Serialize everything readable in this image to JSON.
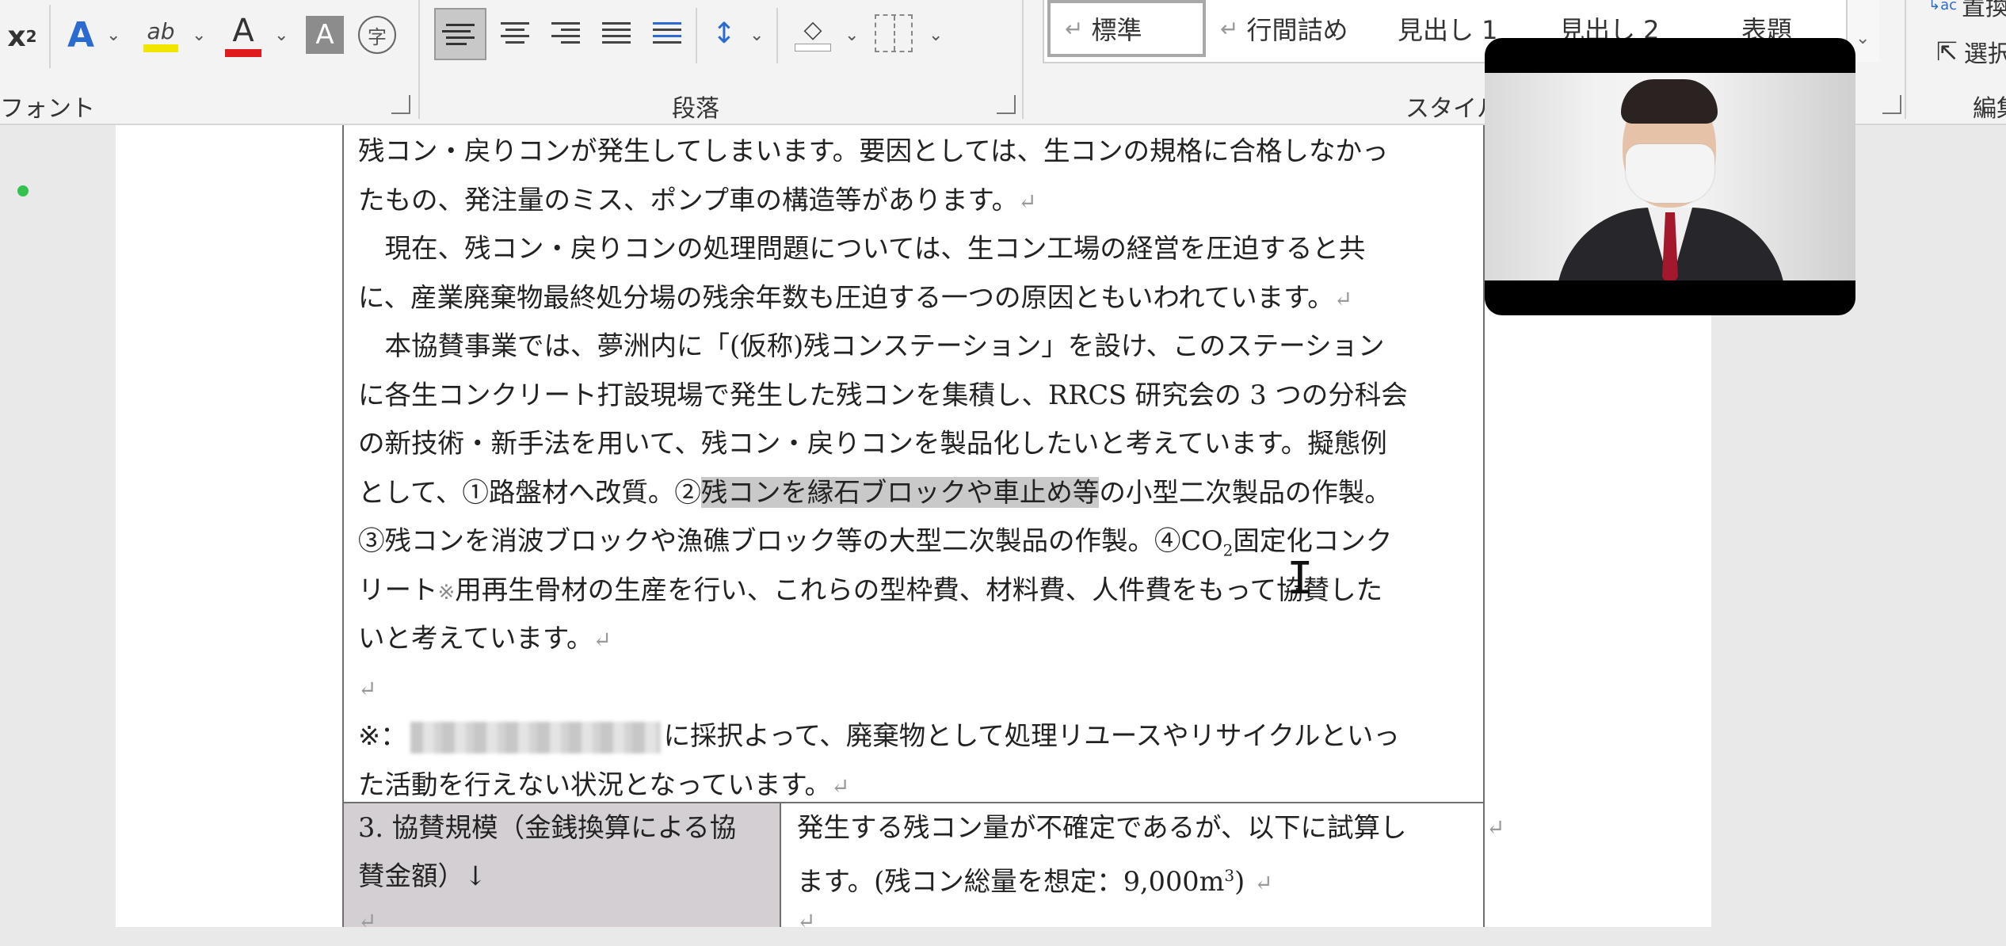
{
  "ribbon": {
    "superscript_label": "x²",
    "groups": {
      "font": "フォント",
      "paragraph": "段落",
      "styles": "スタイル",
      "editing": "編集"
    },
    "styles_gallery": [
      {
        "label": "標準",
        "selected": true
      },
      {
        "label": "行間詰め",
        "selected": false
      },
      {
        "label": "見出し 1",
        "selected": false
      },
      {
        "label": "見出し 2",
        "selected": false
      },
      {
        "label": "表題",
        "selected": false
      }
    ],
    "editing_items": {
      "replace": "置換",
      "select": "選択"
    },
    "font_color": "#e01b1b",
    "highlight_color": "#f2e600"
  },
  "document": {
    "lines": [
      "残コン・戻りコンが発生してしまいます。要因としては、生コンの規格に合格しなかっ",
      "たもの、発注量のミス、ポンプ車の構造等があります。",
      "　現在、残コン・戻りコンの処理問題については、生コン工場の経営を圧迫すると共",
      "に、産業廃棄物最終処分場の残余年数も圧迫する一つの原因ともいわれています。",
      "　本協賛事業では、夢洲内に「(仮称)残コンステーション」を設け、このステーション",
      "に各生コンクリート打設現場で発生した残コンを集積し、RRCS 研究会の 3 つの分科会",
      "の新技術・新手法を用いて、残コン・戻りコンを製品化したいと考えています。擬態例"
    ],
    "line8": {
      "before": "として、①路盤材へ改質。②",
      "highlight": "残コンを縁石ブロックや車止め等",
      "after": "の小型二次製品の作製。"
    },
    "line9": {
      "before": "③残コンを消波ブロックや漁礁ブロック等の大型二次製品の作製。④CO",
      "sub": "2",
      "after": "固定化コンク"
    },
    "line10": {
      "before": "リート",
      "note_mark": "※",
      "after": "用再生骨材の生産を行い、これらの型枠費、材料費、人件費をもって協賛した"
    },
    "line11": "いと考えています。",
    "note_line1": {
      "prefix": "※：",
      "after": "に採択よって、廃棄物として処理リユースやリサイクルといっ"
    },
    "note_line2": "た活動を行えない状況となっています。",
    "paragraph_mark": "↵"
  },
  "table": {
    "left_line1": "3. 協賛規模（金銭換算による協",
    "left_line2": "賛金額）↓",
    "right_line1": "発生する残コン量が不確定であるが、以下に試算し",
    "right_line2_before": "ます。(残コン総量を想定：9,000m",
    "right_line2_sup": "3",
    "right_line2_after": ")"
  }
}
